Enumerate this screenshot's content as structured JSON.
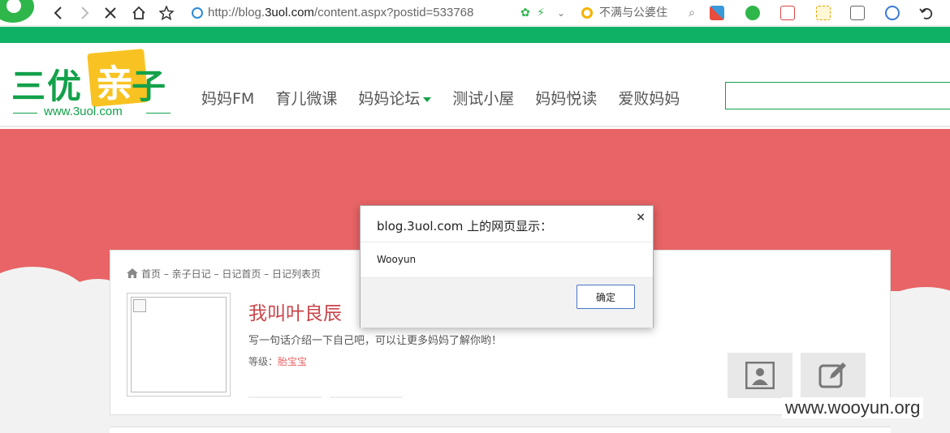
{
  "browser": {
    "url_prefix": "http://blog.",
    "url_domain": "3uol.com",
    "url_path": "/content.aspx?postid=533768",
    "search_text": "不满与公婆住"
  },
  "site": {
    "logo_text": "三优",
    "logo_highlight": "亲",
    "logo_suffix": "子",
    "logo_url": "www.3uol.com",
    "nav": [
      "妈妈FM",
      "育儿微课",
      "妈妈论坛",
      "测试小屋",
      "妈妈悦读",
      "爱败妈妈"
    ],
    "search_placeholder": ""
  },
  "profile": {
    "breadcrumb": [
      "首页",
      "亲子日记",
      "日记首页",
      "日记列表页"
    ],
    "breadcrumb_sep": " – ",
    "username": "我叫叶良辰",
    "intro": "写一句话介绍一下自己吧，可以让更多妈妈了解你哟！",
    "level_label": "等级：",
    "level_value": "胎宝宝"
  },
  "dialog": {
    "title": "blog.3uol.com 上的网页显示：",
    "message": "Wooyun",
    "ok_label": "确定",
    "close_symbol": "×"
  },
  "watermark": "www.wooyun.org",
  "colors": {
    "brand_green": "#0fb264",
    "hero_red": "#e86466",
    "accent_red": "#c9464b"
  }
}
